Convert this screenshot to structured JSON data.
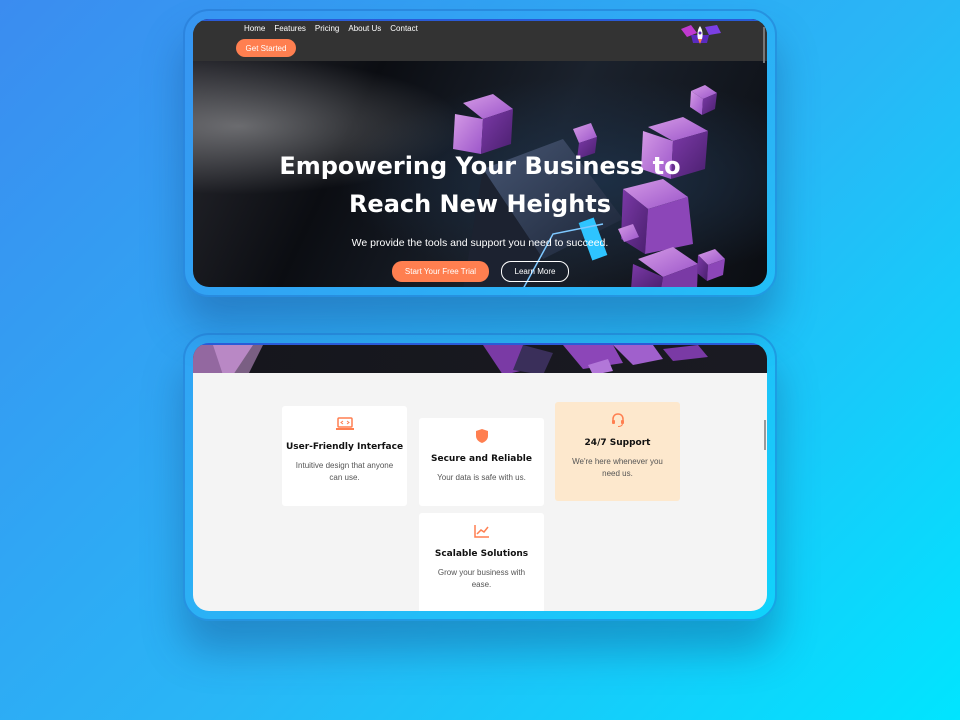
{
  "nav": {
    "links": [
      "Home",
      "Features",
      "Pricing",
      "About Us",
      "Contact"
    ],
    "cta": "Get Started",
    "logo_icon": "rocket-logo-icon"
  },
  "hero": {
    "title": "Empowering Your Business to Reach New Heights",
    "subtitle": "We provide the tools and support you need to succeed.",
    "primary_cta": "Start Your Free Trial",
    "secondary_cta": "Learn More"
  },
  "features": [
    {
      "icon": "code-laptop-icon",
      "title": "User-Friendly Interface",
      "text": "Intuitive design that anyone can use."
    },
    {
      "icon": "shield-icon",
      "title": "Secure and Reliable",
      "text": "Your data is safe with us."
    },
    {
      "icon": "headset-icon",
      "title": "24/7 Support",
      "text": "We're here whenever you need us."
    },
    {
      "icon": "chart-line-icon",
      "title": "Scalable Solutions",
      "text": "Grow your business with ease."
    }
  ],
  "colors": {
    "accent": "#ff7f50",
    "nav_bg": "#333333",
    "highlight_card": "#fde8cd",
    "section_bg": "#f4f4f4"
  }
}
